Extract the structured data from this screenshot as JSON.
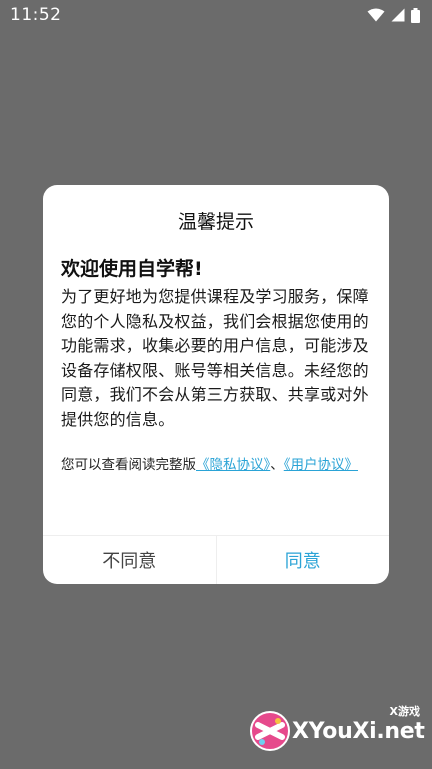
{
  "status_bar": {
    "time": "11:52"
  },
  "dialog": {
    "title": "温馨提示",
    "heading": "欢迎使用自学帮!",
    "body": "为了更好地为您提供课程及学习服务，保障您的个人隐私及权益，我们会根据您使用的功能需求，收集必要的用户信息，可能涉及设备存储权限、账号等相关信息。未经您的同意，我们不会从第三方获取、共享或对外提供您的信息。",
    "links_prefix": "您可以查看阅读完整版",
    "privacy_link": "《隐私协议》",
    "separator": "、",
    "user_link": "《用户协议》",
    "disagree_label": "不同意",
    "agree_label": "同意"
  },
  "watermark": {
    "small_text": "X游戏",
    "main_text": "XYouXi.net"
  },
  "colors": {
    "accent": "#2aa3d6",
    "overlay": "#6b6b6b"
  }
}
